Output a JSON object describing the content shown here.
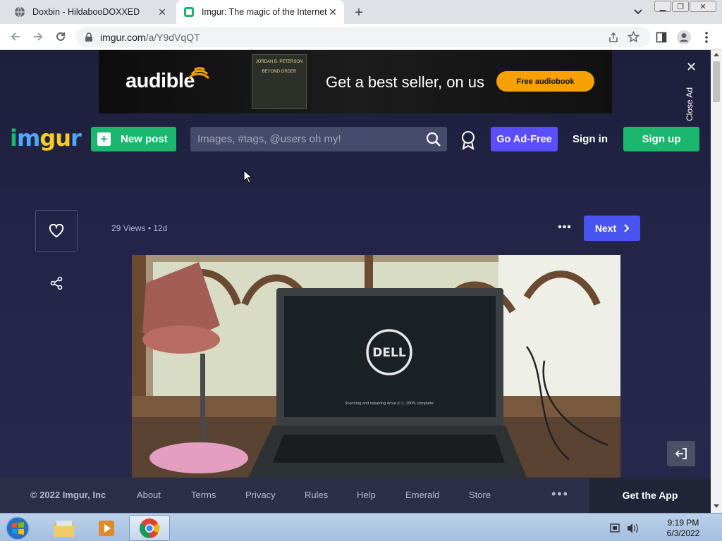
{
  "browser": {
    "tabs": [
      {
        "title": "Doxbin - HildabooDOXXED",
        "active": false
      },
      {
        "title": "Imgur: The magic of the Internet",
        "active": true
      }
    ],
    "url_host": "imgur.com",
    "url_path": "/a/Y9dVqQT"
  },
  "ad": {
    "brand": "audible",
    "book_author": "JORDAN B. PETERSON",
    "book_title": "BEYOND ORDER",
    "headline": "Get a best seller, on us",
    "cta": "Free audiobook",
    "close_label": "Close Ad"
  },
  "header": {
    "logo": "imgur",
    "new_post": "New post",
    "search_placeholder": "Images, #tags, @users oh my!",
    "go_ad_free": "Go Ad-Free",
    "sign_in": "Sign in",
    "sign_up": "Sign up"
  },
  "post": {
    "views": "29 Views",
    "age": "12d",
    "next_label": "Next",
    "screen_text": "Scanning and repairing drive (C:): 100% complete",
    "screen_brand": "DELL"
  },
  "footer": {
    "copyright": "© 2022 Imgur, Inc",
    "links": [
      "About",
      "Terms",
      "Privacy",
      "Rules",
      "Help",
      "Emerald",
      "Store"
    ],
    "get_app": "Get the App"
  },
  "taskbar": {
    "time": "9:19 PM",
    "date": "6/3/2022"
  },
  "colors": {
    "imgur_green": "#1bb76e",
    "ad_free_purple": "#5b4eff",
    "next_blue": "#4a54f0",
    "page_bg": "#1e1f3b",
    "audible_orange": "#f7a000"
  }
}
